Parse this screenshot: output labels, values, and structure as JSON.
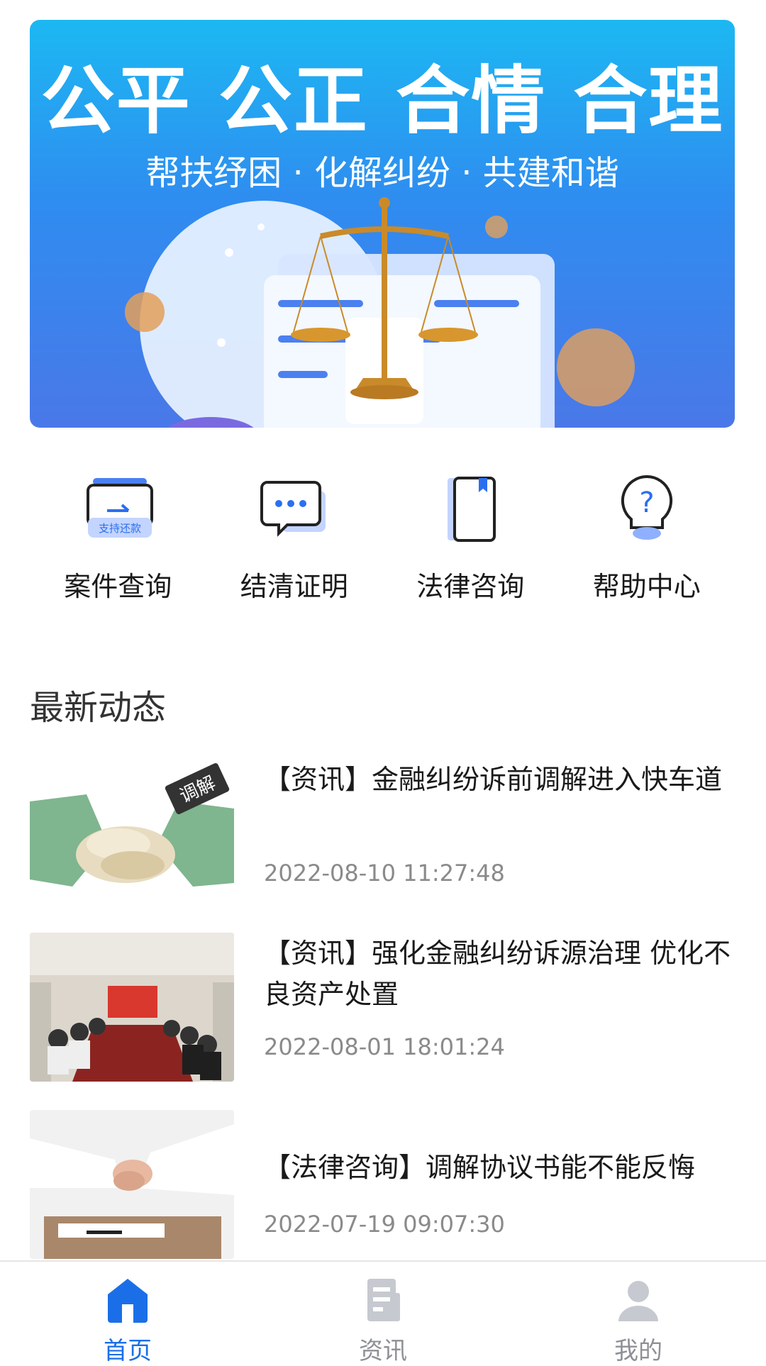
{
  "banner": {
    "title": "公平 公正 合情 合理",
    "subtitle": "帮扶纾困 · 化解纠纷 · 共建和谐"
  },
  "shortcuts": [
    {
      "label": "案件查询",
      "icon": "case-search-icon",
      "badge": "支持还款"
    },
    {
      "label": "结清证明",
      "icon": "chat-bubble-icon"
    },
    {
      "label": "法律咨询",
      "icon": "book-icon"
    },
    {
      "label": "帮助中心",
      "icon": "question-bulb-icon"
    }
  ],
  "section": {
    "title": "最新动态"
  },
  "news": [
    {
      "title": "【资讯】金融纠纷诉前调解进入快车道",
      "date": "2022-08-10 11:27:48",
      "thumb_label": "调解"
    },
    {
      "title": "【资讯】强化金融纠纷诉源治理 优化不良资产处置",
      "date": "2022-08-01 18:01:24"
    },
    {
      "title": "【法律咨询】调解协议书能不能反悔",
      "date": "2022-07-19 09:07:30"
    }
  ],
  "tabbar": {
    "active_color": "#1a6fe8",
    "inactive_color": "#8e9096",
    "tabs": [
      {
        "label": "首页",
        "icon": "home-icon",
        "active": true
      },
      {
        "label": "资讯",
        "icon": "news-doc-icon",
        "active": false
      },
      {
        "label": "我的",
        "icon": "user-icon",
        "active": false
      }
    ]
  }
}
